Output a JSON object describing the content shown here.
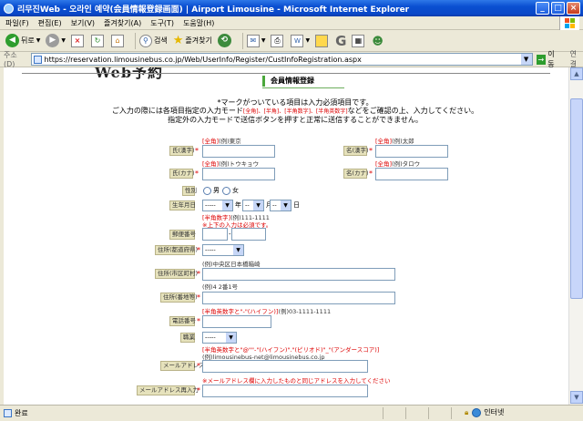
{
  "window": {
    "title": "리무진Web - 오라인 예약(会員情報登録画面) | Airport Limousine - Microsoft Internet Explorer",
    "min": "_",
    "max": "□",
    "close": "×"
  },
  "menu": [
    "파일(F)",
    "편집(E)",
    "보기(V)",
    "즐겨찾기(A)",
    "도구(T)",
    "도움말(H)"
  ],
  "toolbar": {
    "back": "뒤로",
    "search": "검색",
    "favorites": "즐겨찾기"
  },
  "address": {
    "label": "주소(D)",
    "url": "https://reservation.limousinebus.co.jp/Web/UserInfo/Register/CustInfoRegistration.aspx",
    "go": "이동",
    "links": "연결"
  },
  "page": {
    "header_text": "Web予約",
    "section_title": "会員情報登録",
    "intro": {
      "line1": "*マークがついている項目は入力必須項目です。",
      "line2_a": "ご入力の際には各項目指定の入力モード",
      "line2_modes": "[全角]、[半角]、[半角数字]、[半角英数字]",
      "line2_b": "などをご確認の上、入力してください。",
      "line3": "指定外の入力モードで送信ボタンを押すと正常に送信することができません。"
    },
    "fields": {
      "last_name": {
        "label": "氏(漢字)",
        "hint_mode": "[全角]",
        "hint_example": "(例)東京"
      },
      "first_name": {
        "label": "名(漢字)",
        "hint_mode": "[全角]",
        "hint_example": "(例)太郎"
      },
      "last_kana": {
        "label": "氏(カナ)",
        "hint_mode": "[全角]",
        "hint_example": "(例)トウキョウ"
      },
      "first_kana": {
        "label": "名(カナ)",
        "hint_mode": "[全角]",
        "hint_example": "(例)タロウ"
      },
      "gender": {
        "label": "性別",
        "male": "男",
        "female": "女"
      },
      "birthday": {
        "label": "生年月日",
        "year": "-----",
        "year_unit": "年",
        "month": "--",
        "month_unit": "月",
        "day": "--",
        "day_unit": "日"
      },
      "zip": {
        "label": "郵便番号",
        "hint_mode": "[半角数字]",
        "hint_example": "(例)111-1111",
        "hint_note": "※上下の入力は必須です。"
      },
      "prefecture": {
        "label": "住所(都道府県)",
        "value": "-----"
      },
      "city": {
        "label": "住所(市区町村)",
        "hint": "(例)中央区日本橋箱崎"
      },
      "street": {
        "label": "住所(番地等)",
        "hint": "(例)4 2番1号"
      },
      "phone": {
        "label": "電話番号",
        "hint_mode": "[半角英数字と\"-\"(ハイフン)]",
        "hint_example": "(例)03-1111-1111"
      },
      "occupation": {
        "label": "職業",
        "value": "-----"
      },
      "email": {
        "label": "メールアドレス",
        "hint_mode": "[半角英数字と\"@\"\"-\"(ハイフン)\".\"(ピリオド)\"_\"(アンダースコア)]",
        "hint_example": "(例)limousinebus-net@limousinebus.co.jp"
      },
      "email_confirm": {
        "label": "メールアドレス再入力",
        "hint": "※メールアドレス欄に入力したものと同じアドレスを入力してください"
      }
    },
    "required_mark": "*"
  },
  "status": {
    "text": "완료",
    "zone": "인터넷"
  }
}
